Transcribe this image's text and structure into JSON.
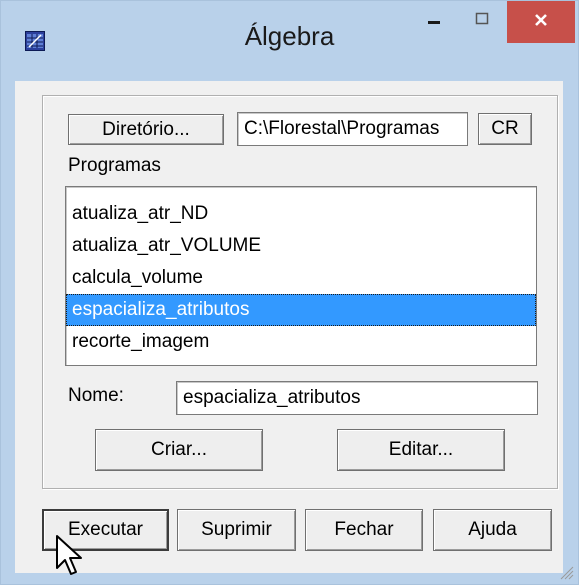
{
  "window": {
    "title": "Álgebra",
    "icon": "table-grid-icon",
    "controls": {
      "minimize": "minimize-icon",
      "maximize": "maximize-icon",
      "close": "close-icon"
    }
  },
  "directory": {
    "button_label": "Diretório...",
    "path_value": "C:\\Florestal\\Programas",
    "cr_label": "CR"
  },
  "programs": {
    "label": "Programas",
    "items": [
      "atualiza_atr_ND",
      "atualiza_atr_VOLUME",
      "calcula_volume",
      "espacializa_atributos",
      "recorte_imagem"
    ],
    "selected": "espacializa_atributos"
  },
  "name": {
    "label": "Nome:",
    "value": "espacializa_atributos"
  },
  "actions": {
    "create": "Criar...",
    "edit": "Editar..."
  },
  "footer": {
    "execute": "Executar",
    "delete": "Suprimir",
    "close": "Fechar",
    "help": "Ajuda"
  },
  "colors": {
    "titlebar": "#b9d1ea",
    "close_button": "#c7504a",
    "selection": "#3399ff"
  }
}
